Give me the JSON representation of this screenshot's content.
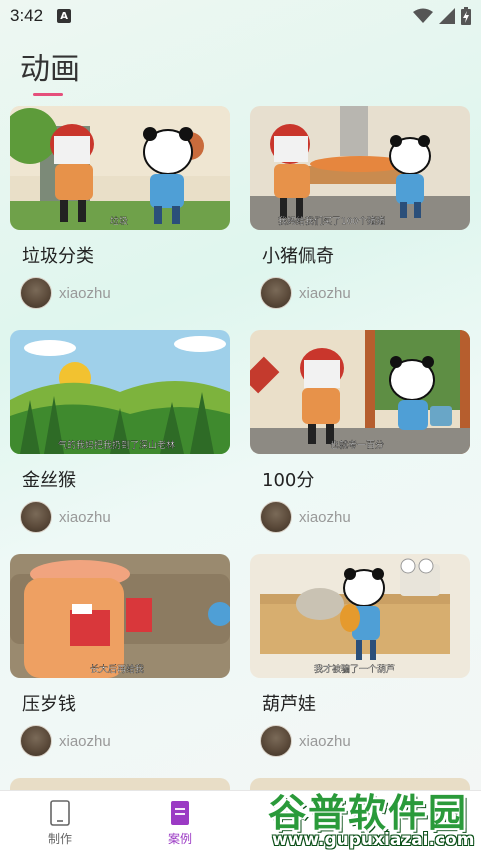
{
  "status_bar": {
    "time": "3:42",
    "notification_icon": "a-square-icon",
    "wifi_icon": "wifi-icon",
    "signal_icon": "signal-icon",
    "battery_icon": "battery-charging-icon"
  },
  "page": {
    "title": "动画",
    "accent_color": "#e54f7b"
  },
  "cards": [
    {
      "title": "垃圾分类",
      "author": "xiaozhu",
      "caption": "垃圾"
    },
    {
      "title": "小猪佩奇",
      "author": "xiaozhu",
      "caption": "我妈给我们买了100个猪猪"
    },
    {
      "title": "金丝猴",
      "author": "xiaozhu",
      "caption": "气的我妈把我扔到了深山老林"
    },
    {
      "title": "100分",
      "author": "xiaozhu",
      "caption": "也就考一百分"
    },
    {
      "title": "压岁钱",
      "author": "xiaozhu",
      "caption": "长大后再给我"
    },
    {
      "title": "葫芦娃",
      "author": "xiaozhu",
      "caption": "我才被骗了一个葫芦"
    }
  ],
  "bottom_nav": {
    "items": [
      {
        "label": "制作",
        "icon": "tablet-icon",
        "active": false
      },
      {
        "label": "案例",
        "icon": "document-icon",
        "active": true
      }
    ],
    "active_color": "#9b3ac4"
  },
  "watermark": {
    "text": "谷普软件园",
    "url": "www.gupuxiazai.com"
  }
}
